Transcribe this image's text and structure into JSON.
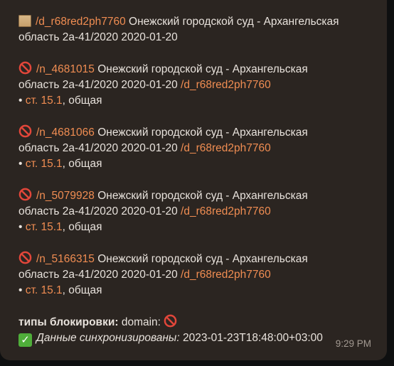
{
  "doc_link": "/d_r68red2ph7760",
  "header_text": "Онежский городской суд - Архангельская",
  "header_text2": "область 2а-41/2020 2020-01-20",
  "entries": [
    {
      "id": "/n_4681015",
      "court": "Онежский городской суд - Архангельская",
      "case": "область 2а-41/2020 2020-01-20",
      "doc": "/d_r68red2ph7760",
      "bullet": "• ",
      "article": "ст. 15.1",
      "type": ", общая"
    },
    {
      "id": "/n_4681066",
      "court": "Онежский городской суд - Архангельская",
      "case": "область 2а-41/2020 2020-01-20",
      "doc": "/d_r68red2ph7760",
      "bullet": "• ",
      "article": "ст. 15.1",
      "type": ", общая"
    },
    {
      "id": "/n_5079928",
      "court": "Онежский городской суд - Архангельская",
      "case": "область 2а-41/2020 2020-01-20",
      "doc": "/d_r68red2ph7760",
      "bullet": "• ",
      "article": "ст. 15.1",
      "type": ", общая"
    },
    {
      "id": "/n_5166315",
      "court": "Онежский городской суд - Архангельская",
      "case": "область 2а-41/2020 2020-01-20",
      "doc": "/d_r68red2ph7760",
      "bullet": "• ",
      "article": "ст. 15.1",
      "type": ", общая"
    }
  ],
  "block_types_label": "типы блокировки:",
  "block_types_value": "domain:",
  "sync_label": "Данные синхронизированы:",
  "sync_value": "2023-01-23T18:48:00+03:00",
  "time": "9:29 PM",
  "colors": {
    "link": "#f08d52",
    "bubble": "#2b2521",
    "prohibited": "#e2463a",
    "check": "#4fae3a"
  },
  "icons": {
    "header": "scroll-icon",
    "entry": "prohibited-icon",
    "sync": "check-mark-icon"
  }
}
